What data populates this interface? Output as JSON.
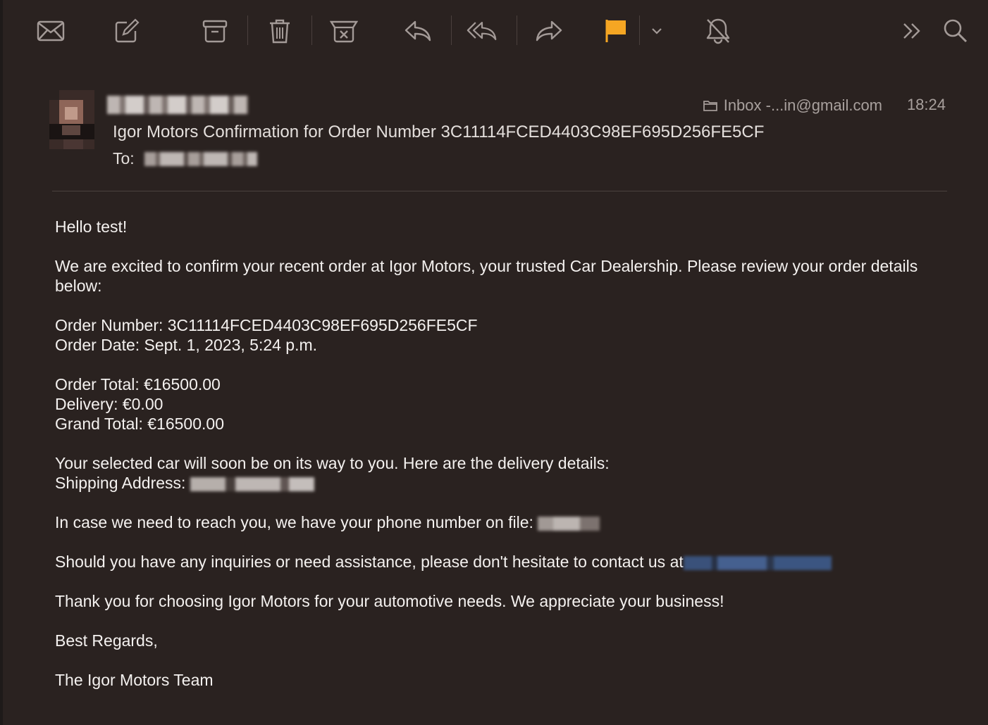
{
  "toolbar": {
    "items": [
      {
        "name": "get-mail-icon"
      },
      {
        "name": "compose-icon"
      },
      {
        "name": "archive-icon"
      },
      {
        "name": "trash-icon"
      },
      {
        "name": "junk-icon"
      },
      {
        "name": "reply-icon"
      },
      {
        "name": "reply-all-icon"
      },
      {
        "name": "forward-icon"
      },
      {
        "name": "flag-icon",
        "color": "#f5a623"
      },
      {
        "name": "chevron-down-icon"
      },
      {
        "name": "mute-bell-icon"
      },
      {
        "name": "overflow-chevrons-icon"
      },
      {
        "name": "search-icon"
      }
    ]
  },
  "message": {
    "mailbox": "Inbox -...in@gmail.com",
    "time": "18:24",
    "subject": "Igor Motors Confirmation for Order Number 3C11114FCED4403C98EF695D256FE5CF",
    "to_label": "To:"
  },
  "body": {
    "greeting": "Hello test!",
    "intro": "We are excited to confirm your recent order at Igor Motors, your trusted Car Dealership. Please review your order details below:",
    "order_number": "Order Number: 3C11114FCED4403C98EF695D256FE5CF",
    "order_date": "Order Date: Sept. 1, 2023, 5:24 p.m.",
    "order_total": "Order Total: €16500.00",
    "delivery": "Delivery: €0.00",
    "grand_total": "Grand Total: €16500.00",
    "delivery_intro": "Your selected car will soon be on its way to you. Here are the delivery details:",
    "shipping_label": "Shipping Address: ",
    "phone_text": "In case we need to reach you, we have your phone number on file: ",
    "contact_text": "Should you have any inquiries or need assistance, please don't hesitate to contact us at",
    "thanks": "Thank you for choosing Igor Motors for your automotive needs. We appreciate your business!",
    "regards": "Best Regards,",
    "signature": "The Igor Motors Team"
  },
  "colors": {
    "background": "#2a2220",
    "flag": "#f5a623",
    "icon": "#a39a97"
  }
}
